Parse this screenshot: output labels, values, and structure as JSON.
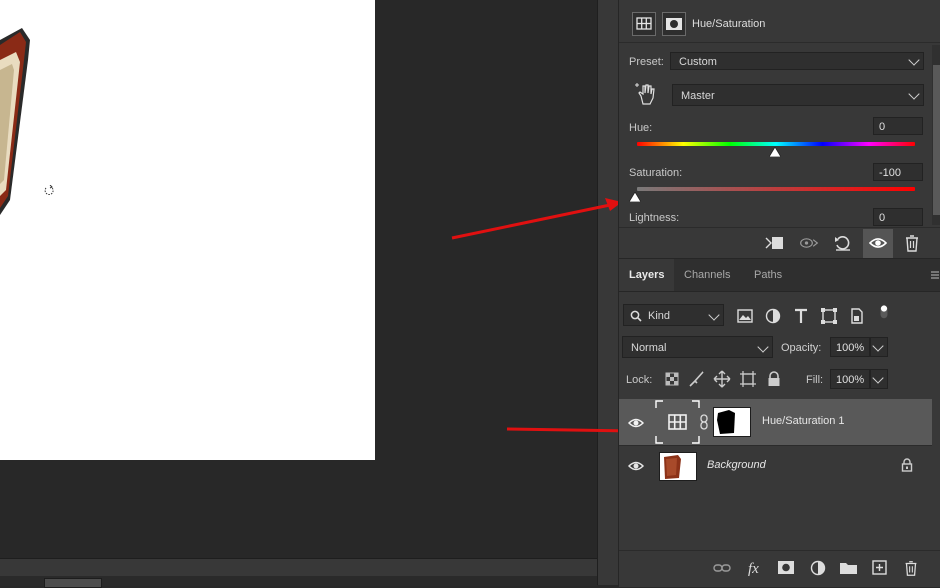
{
  "properties": {
    "title": "Hue/Saturation",
    "preset_label": "Preset:",
    "preset_value": "Custom",
    "channel_value": "Master",
    "hue_label": "Hue:",
    "hue_value": "0",
    "saturation_label": "Saturation:",
    "saturation_value": "-100",
    "lightness_label": "Lightness:",
    "lightness_value": "0"
  },
  "layers_panel": {
    "tabs": [
      {
        "label": "Layers",
        "active": true
      },
      {
        "label": "Channels",
        "active": false
      },
      {
        "label": "Paths",
        "active": false
      }
    ],
    "filter_kind": "Kind",
    "blend_mode": "Normal",
    "opacity_label": "Opacity:",
    "opacity_value": "100%",
    "lock_label": "Lock:",
    "fill_label": "Fill:",
    "fill_value": "100%",
    "layers": [
      {
        "name": "Hue/Saturation 1",
        "selected": true,
        "visible": true
      },
      {
        "name": "Background",
        "selected": false,
        "visible": true,
        "locked": true
      }
    ]
  },
  "colors": {
    "annotation_arrow": "#e01010",
    "panel_bg": "#383838",
    "selected_layer": "#595959"
  }
}
